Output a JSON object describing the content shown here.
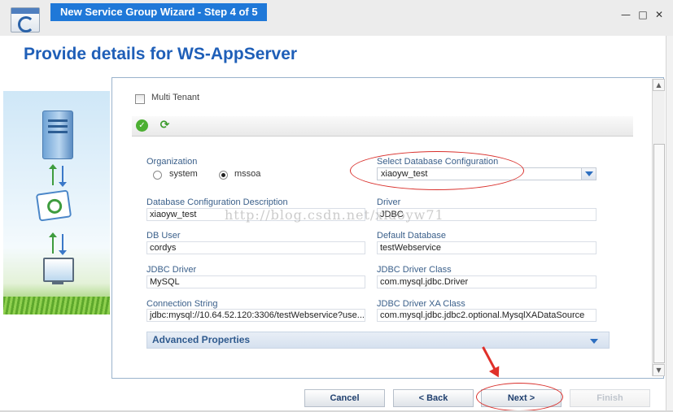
{
  "window": {
    "title": "New Service Group Wizard - Step 4 of 5",
    "controls": {
      "minimize": "—",
      "maximize": "□",
      "close": "✕"
    }
  },
  "header": {
    "title": "Provide details for WS-AppServer"
  },
  "form": {
    "multi_tenant_label": "Multi Tenant",
    "organization": {
      "label": "Organization",
      "options": [
        "system",
        "mssoa"
      ],
      "selected": "mssoa"
    },
    "db_config": {
      "label": "Select Database Configuration",
      "value": "xiaoyw_test"
    },
    "db_config_description": {
      "label": "Database Configuration Description",
      "value": "xiaoyw_test"
    },
    "driver": {
      "label": "Driver",
      "value": "JDBC"
    },
    "db_user": {
      "label": "DB User",
      "value": "cordys"
    },
    "default_database": {
      "label": "Default Database",
      "value": "testWebservice"
    },
    "jdbc_driver": {
      "label": "JDBC Driver",
      "value": "MySQL"
    },
    "jdbc_driver_class": {
      "label": "JDBC Driver Class",
      "value": "com.mysql.jdbc.Driver"
    },
    "connection_string": {
      "label": "Connection String",
      "value": "jdbc:mysql://10.64.52.120:3306/testWebservice?use..."
    },
    "jdbc_driver_xa_class": {
      "label": "JDBC Driver XA Class",
      "value": "com.mysql.jdbc.jdbc2.optional.MysqlXADataSource"
    },
    "advanced_properties": "Advanced Properties"
  },
  "watermark": "http://blog.csdn.net/xiaoyw71",
  "buttons": {
    "cancel": "Cancel",
    "back": "< Back",
    "next": "Next >",
    "finish": "Finish"
  },
  "colors": {
    "accent": "#1f78d8",
    "header": "#1f5fb8",
    "annotation": "#d9302c"
  }
}
